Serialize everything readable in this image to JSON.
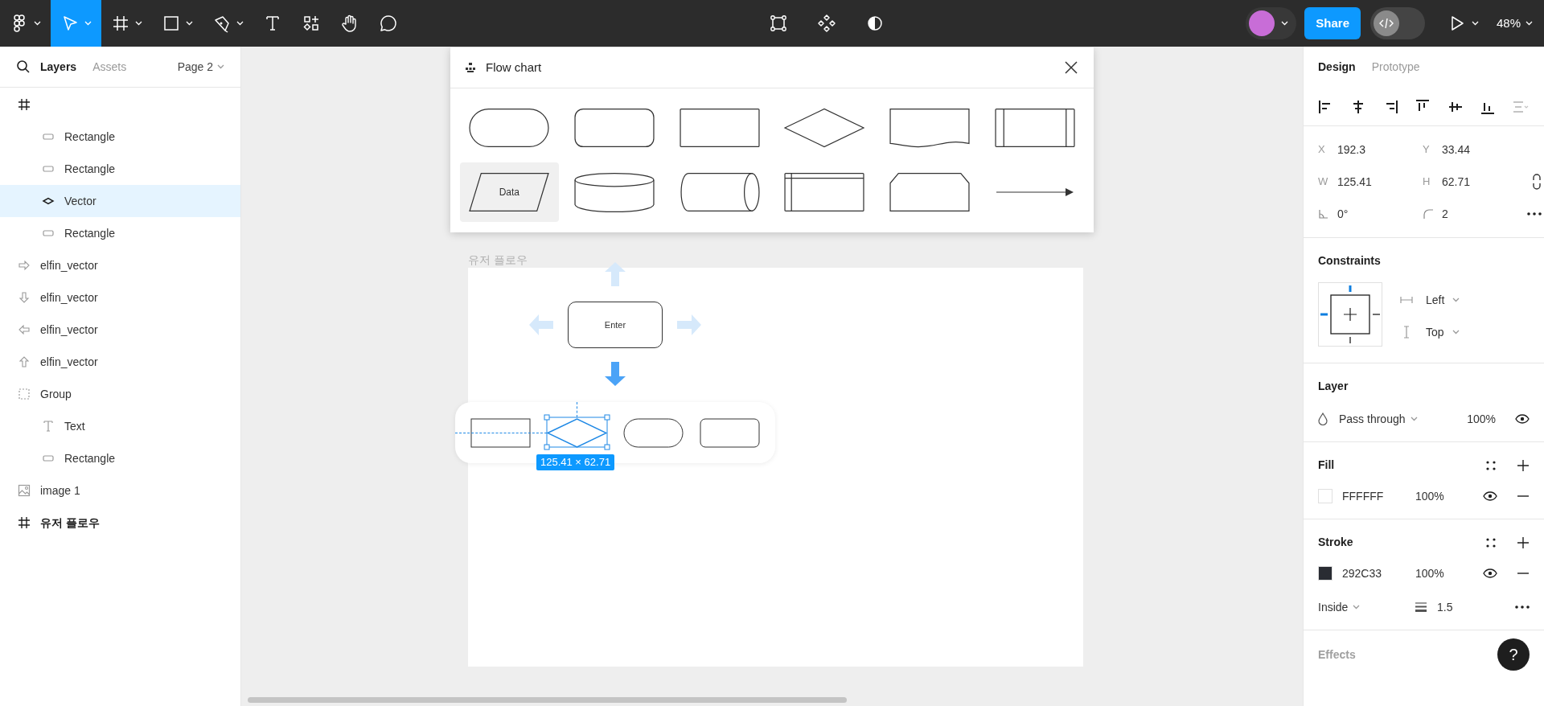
{
  "toolbar": {
    "tools": [
      {
        "kind": "main-menu",
        "caret": true,
        "selected": false
      },
      {
        "kind": "move",
        "caret": true,
        "selected": true
      },
      {
        "kind": "frame",
        "caret": true,
        "selected": false
      },
      {
        "kind": "rectangle",
        "caret": true,
        "selected": false
      },
      {
        "kind": "pen",
        "caret": true,
        "selected": false
      },
      {
        "kind": "text",
        "caret": false,
        "selected": false
      },
      {
        "kind": "resources",
        "caret": false,
        "selected": false
      },
      {
        "kind": "hand",
        "caret": false,
        "selected": false
      },
      {
        "kind": "comment",
        "caret": false,
        "selected": false
      }
    ],
    "center_tools": [
      {
        "kind": "edit-object"
      },
      {
        "kind": "component"
      },
      {
        "kind": "contrast"
      }
    ],
    "share": "Share",
    "dev_mode": {
      "on": false
    },
    "zoom": "48%"
  },
  "layers_panel": {
    "tabs": [
      {
        "label": "Layers",
        "selected": true
      },
      {
        "label": "Assets",
        "selected": false
      }
    ],
    "page": "Page 2",
    "layers": [
      {
        "kind": "frame",
        "selected": false,
        "children": [
          {
            "kind": "rectangle",
            "name": "Rectangle",
            "selected": false
          },
          {
            "kind": "rectangle",
            "name": "Rectangle",
            "selected": false
          },
          {
            "kind": "vector",
            "name": "Vector",
            "selected": true
          },
          {
            "kind": "rectangle",
            "name": "Rectangle",
            "selected": false
          }
        ]
      },
      {
        "kind": "arrow-right",
        "name": "elfin_vector",
        "selected": false
      },
      {
        "kind": "arrow-down",
        "name": "elfin_vector",
        "selected": false
      },
      {
        "kind": "arrow-left",
        "name": "elfin_vector",
        "selected": false
      },
      {
        "kind": "arrow-up",
        "name": "elfin_vector",
        "selected": false
      },
      {
        "kind": "group",
        "name": "Group",
        "selected": false,
        "children": [
          {
            "kind": "text",
            "name": "Text",
            "selected": false
          },
          {
            "kind": "rectangle",
            "name": "Rectangle",
            "selected": false
          }
        ]
      },
      {
        "kind": "image",
        "name": "image 1",
        "selected": false
      },
      {
        "kind": "frame",
        "name": "유저 플로우",
        "selected": false
      }
    ]
  },
  "flowchart_panel": {
    "title": "Flow chart",
    "shapes": [
      {
        "kind": "terminal",
        "selected": false
      },
      {
        "kind": "rounded",
        "selected": false
      },
      {
        "kind": "process",
        "selected": false
      },
      {
        "kind": "decision",
        "selected": false
      },
      {
        "kind": "document",
        "selected": false
      },
      {
        "kind": "subroutine",
        "selected": false
      },
      {
        "kind": "data",
        "label": "Data",
        "selected": true
      },
      {
        "kind": "database",
        "selected": false
      },
      {
        "kind": "cylinder",
        "selected": false
      },
      {
        "kind": "internal-storage",
        "selected": false
      },
      {
        "kind": "loop-limit",
        "selected": false
      },
      {
        "kind": "arrow",
        "selected": false
      }
    ]
  },
  "canvas": {
    "frame_title": "유저 플로우",
    "start_node": "Enter",
    "arrows": [
      {
        "kind": "up",
        "active": false
      },
      {
        "kind": "left",
        "active": false
      },
      {
        "kind": "right",
        "active": false
      },
      {
        "kind": "down",
        "active": true
      }
    ],
    "quick_shapes": [
      {
        "kind": "process",
        "selected": false
      },
      {
        "kind": "decision",
        "selected": true
      },
      {
        "kind": "terminal",
        "selected": false
      },
      {
        "kind": "rounded",
        "selected": false
      }
    ],
    "size_label": "125.41 × 62.71"
  },
  "design_panel": {
    "tabs": [
      {
        "label": "Design",
        "selected": true
      },
      {
        "label": "Prototype",
        "selected": false
      }
    ],
    "align_tools": [
      {
        "kind": "align-left",
        "disabled": false
      },
      {
        "kind": "align-center",
        "disabled": false
      },
      {
        "kind": "align-right",
        "disabled": false
      },
      {
        "kind": "align-top",
        "disabled": false
      },
      {
        "kind": "align-middle",
        "disabled": false
      },
      {
        "kind": "align-bottom",
        "disabled": false
      },
      {
        "kind": "distribute",
        "disabled": true
      }
    ],
    "fields": [
      {
        "kind": "label",
        "label": "X",
        "value": "192.3"
      },
      {
        "kind": "label",
        "label": "Y",
        "value": "33.44"
      },
      {
        "kind": "label",
        "label": "W",
        "value": "125.41"
      },
      {
        "kind": "label",
        "label": "H",
        "value": "62.71"
      },
      {
        "kind": "rotation",
        "value": "0°"
      },
      {
        "kind": "radius",
        "value": "2"
      }
    ],
    "constraints": {
      "title": "Constraints",
      "horizontal": "Left",
      "vertical": "Top",
      "pins": {
        "left": true,
        "top": true,
        "right": false,
        "bottom": false
      }
    },
    "layer": {
      "title": "Layer",
      "blend": "Pass through",
      "opacity": "100%",
      "visible": true
    },
    "fill": {
      "title": "Fill",
      "items": [
        {
          "hex": "FFFFFF",
          "opacity": "100%",
          "visible": true
        }
      ]
    },
    "stroke": {
      "title": "Stroke",
      "items": [
        {
          "hex": "292C33",
          "opacity": "100%",
          "visible": true
        }
      ],
      "position": "Inside",
      "weight": "1.5"
    },
    "effects": {
      "title": "Effects"
    },
    "help": "?"
  }
}
